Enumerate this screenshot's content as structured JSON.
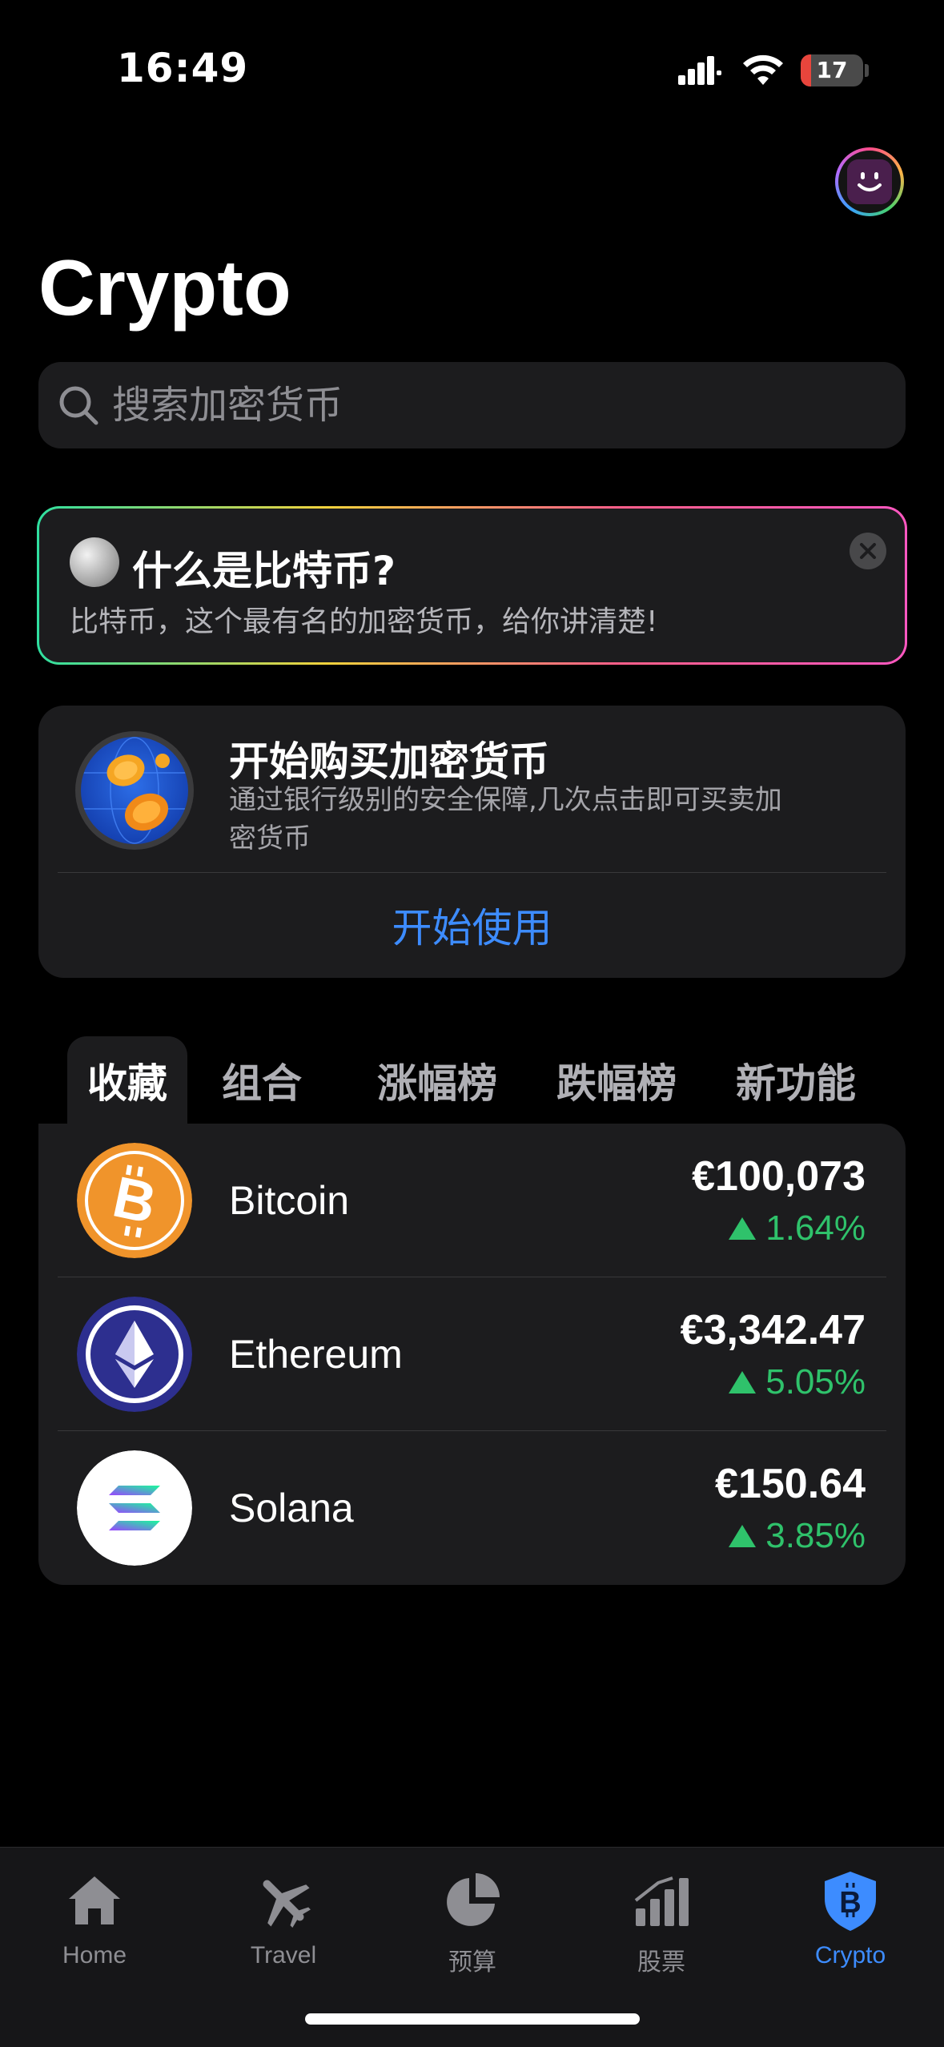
{
  "status_bar": {
    "time": "16:49",
    "battery": "17",
    "battery_level": 0.17
  },
  "header": {
    "title": "Crypto"
  },
  "search": {
    "placeholder": "搜索加密货币"
  },
  "info_card": {
    "title": "什么是比特币?",
    "subtitle": "比特币，这个最有名的加密货币，给你讲清楚!"
  },
  "buy_card": {
    "title": "开始购买加密货币",
    "description": "通过银行级别的安全保障,几次点击即可买卖加密货币",
    "cta": "开始使用"
  },
  "tabs": [
    {
      "label": "收藏",
      "active": true
    },
    {
      "label": "组合",
      "active": false
    },
    {
      "label": "涨幅榜",
      "active": false
    },
    {
      "label": "跌幅榜",
      "active": false
    },
    {
      "label": "新功能",
      "active": false
    }
  ],
  "coins": [
    {
      "name": "Bitcoin",
      "price": "€100,073",
      "change": "1.64%",
      "icon": "bitcoin-icon",
      "color": "#f0942b"
    },
    {
      "name": "Ethereum",
      "price": "€3,342.47",
      "change": "5.05%",
      "icon": "ethereum-icon",
      "color": "#2d2f8f"
    },
    {
      "name": "Solana",
      "price": "€150.64",
      "change": "3.85%",
      "icon": "solana-icon",
      "color": "#ffffff"
    }
  ],
  "tab_bar": [
    {
      "label": "Home",
      "icon": "house-icon",
      "active": false
    },
    {
      "label": "Travel",
      "icon": "airplane-icon",
      "active": false
    },
    {
      "label": "预算",
      "icon": "pie-chart-icon",
      "active": false
    },
    {
      "label": "股票",
      "icon": "bar-chart-icon",
      "active": false
    },
    {
      "label": "Crypto",
      "icon": "bitcoin-shield-icon",
      "active": true
    }
  ],
  "colors": {
    "accent": "#3d8cff",
    "positive": "#2fc26b",
    "card": "#1c1c1e",
    "background": "#000000"
  }
}
